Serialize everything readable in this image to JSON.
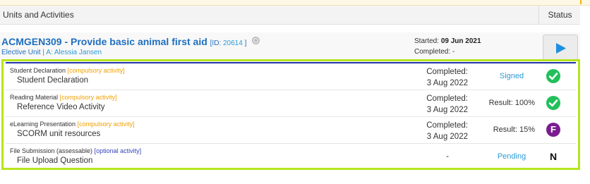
{
  "header": {
    "units_label": "Units and Activities",
    "status_label": "Status"
  },
  "unit": {
    "code_title": "ACMGEN309 - Provide basic animal first aid",
    "id_prefix": "[ID: ",
    "id_value": "20614",
    "id_suffix": " ]",
    "type": "Elective Unit",
    "separator": " | ",
    "assessor": "A: Alessia Jansen",
    "started_label": "Started: ",
    "started_date": "09 Jun 2021",
    "completed_label": "Completed: -",
    "icons": {
      "globe": "globe-icon",
      "play": "play-icon"
    },
    "colors": {
      "title": "#1f6fbf",
      "play": "#1e90e0"
    }
  },
  "activities": [
    {
      "type": "Student Declaration",
      "tag": "[compulsory activity]",
      "name": "Student Declaration",
      "completed_label": "Completed:",
      "date": "3 Aug 2022",
      "result": "Signed",
      "status_icon": "check-icon"
    },
    {
      "type": "Reading Material",
      "tag": "[compulsory activity]",
      "name": "Reference Video Activity",
      "completed_label": "Completed:",
      "date": "3 Aug 2022",
      "result": "Result: 100%",
      "status_icon": "check-icon"
    },
    {
      "type": "eLearning Presentation",
      "tag": "[compulsory activity]",
      "name": "SCORM unit resources",
      "completed_label": "Completed:",
      "date": "3 Aug 2022",
      "result": "Result: 15%",
      "status_icon": "fail-icon",
      "status_text": "F"
    },
    {
      "type": "File Submission (assessable)",
      "tag": "[optional activity]",
      "name": "File Upload Question",
      "completed": "-",
      "result": "Pending",
      "status_icon": "not-started-icon",
      "status_text": "N"
    }
  ],
  "colors": {
    "highlight": "#b5e51d",
    "check": "#21c05a",
    "fail": "#7a1d8f",
    "compulsory": "#f0a000",
    "optional": "#3344bb",
    "link": "#2a9bd6"
  }
}
